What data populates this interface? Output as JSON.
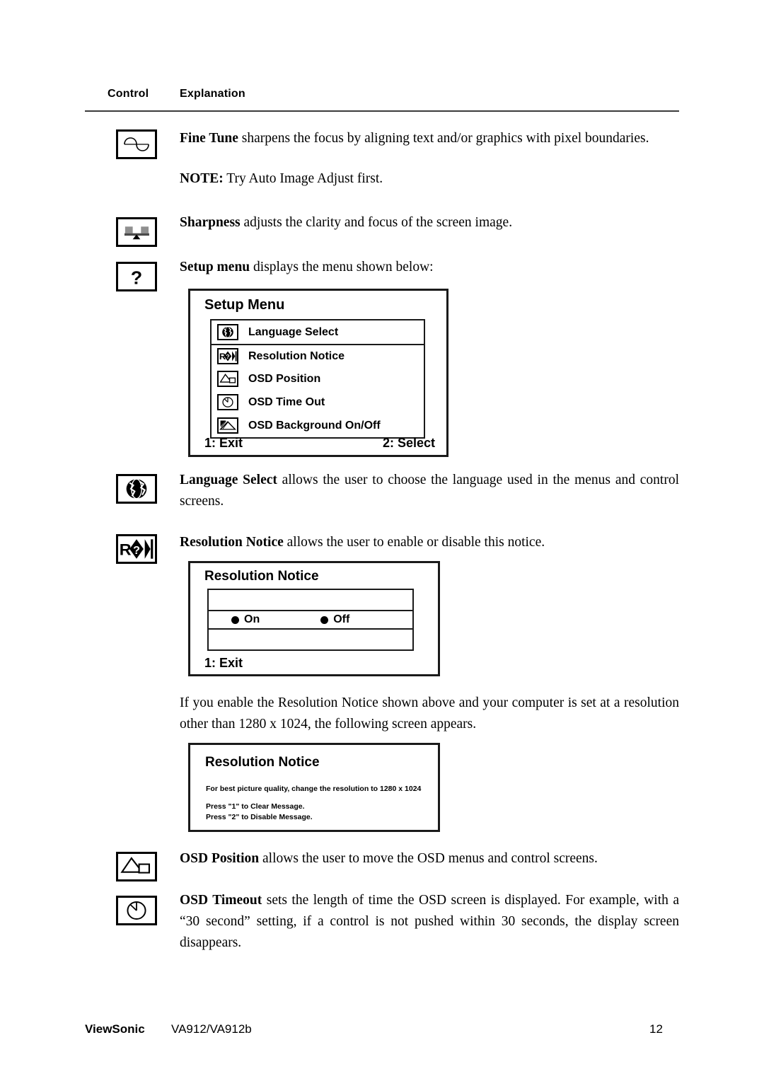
{
  "header": {
    "col_control": "Control",
    "col_explanation": "Explanation"
  },
  "rows": [
    {
      "icon": "fine-tune-sine-icon",
      "term": "Fine Tune",
      "body": " sharpens the focus by aligning text and/or graphics with pixel boundaries.",
      "note_label": "NOTE:",
      "note_body": " Try Auto Image Adjust first."
    },
    {
      "icon": "sharpness-balance-icon",
      "term": "Sharpness",
      "body": " adjusts the clarity and focus of the screen image."
    },
    {
      "icon": "setup-menu-question-icon",
      "term": "Setup menu",
      "body": " displays the menu shown below:"
    },
    {
      "icon": "globe-icon",
      "term": "Language Select",
      "body": " allows the user to choose the language used in the menus and control screens."
    },
    {
      "icon": "resolution-notice-icon",
      "term": "Resolution Notice",
      "body": " allows the user to enable or disable this notice."
    },
    {
      "icon": "osd-position-icon",
      "term": "OSD Position",
      "body": " allows the user to move the OSD menus and control screens."
    },
    {
      "icon": "osd-timeout-clock-icon",
      "term": "OSD Timeout",
      "body": " sets the length of time the OSD screen is displayed. For example, with a “30 second” setting, if a control is not pushed within 30 seconds, the display screen disappears."
    }
  ],
  "setup_menu": {
    "title": "Setup Menu",
    "items": [
      {
        "icon": "globe-icon",
        "label": "Language Select"
      },
      {
        "icon": "resolution-notice-icon",
        "label": "Resolution Notice"
      },
      {
        "icon": "osd-position-icon",
        "label": "OSD Position"
      },
      {
        "icon": "osd-timeout-clock-icon",
        "label": "OSD Time Out"
      },
      {
        "icon": "osd-background-icon",
        "label": "OSD Background On/Off"
      }
    ],
    "exit_label": "1: Exit",
    "select_label": "2: Select"
  },
  "resolution_notice_dialog": {
    "title": "Resolution Notice",
    "option_on": "On",
    "option_off": "Off",
    "exit_label": "1: Exit"
  },
  "body_paragraph": "If you enable the Resolution Notice shown above and your computer is set at a resolution other than 1280 x 1024, the following screen appears.",
  "resolution_warning_screen": {
    "title": "Resolution Notice",
    "line1": "For best picture quality, change the resolution to 1280 x 1024",
    "line2": "Press \"1\" to Clear Message.",
    "line3": "Press \"2\" to Disable Message."
  },
  "footer": {
    "brand": "ViewSonic",
    "model": "VA912/VA912b",
    "page_number": "12"
  },
  "colors": {
    "ink": "#000000",
    "rule": "#3b3b3b",
    "icon_gray": "#8f8f8f",
    "paper": "#ffffff"
  }
}
